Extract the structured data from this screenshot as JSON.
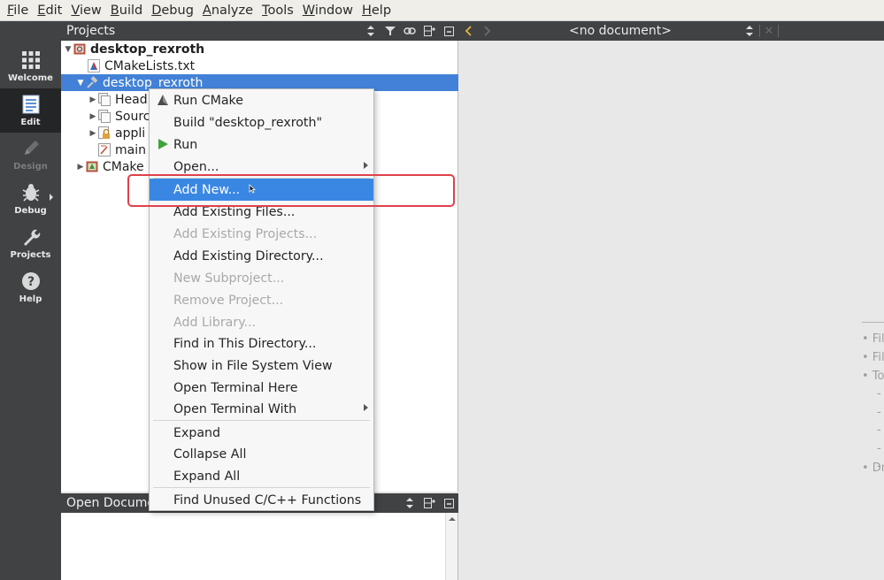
{
  "menubar": [
    "File",
    "Edit",
    "View",
    "Build",
    "Debug",
    "Analyze",
    "Tools",
    "Window",
    "Help"
  ],
  "modes": [
    {
      "label": "Welcome",
      "icon": "grid-icon",
      "state": "normal"
    },
    {
      "label": "Edit",
      "icon": "document-icon",
      "state": "active"
    },
    {
      "label": "Design",
      "icon": "pencil-icon",
      "state": "disabled"
    },
    {
      "label": "Debug",
      "icon": "bug-icon",
      "state": "normal"
    },
    {
      "label": "Projects",
      "icon": "wrench-icon",
      "state": "normal"
    },
    {
      "label": "Help",
      "icon": "help-icon",
      "state": "normal"
    }
  ],
  "projects_panel": {
    "title": "Projects",
    "tree": [
      {
        "label": "desktop_rexroth",
        "depth": 0,
        "expanded": true,
        "icon": "project-icon",
        "bold": true
      },
      {
        "label": "CMakeLists.txt",
        "depth": 1,
        "icon": "cmake-file-icon"
      },
      {
        "label": "desktop_rexroth",
        "depth": 1,
        "expanded": true,
        "icon": "hammer-icon",
        "selected": true
      },
      {
        "label": "Head",
        "depth": 2,
        "icon": "headers-folder-icon"
      },
      {
        "label": "Sourc",
        "depth": 2,
        "icon": "sources-folder-icon"
      },
      {
        "label": "appli",
        "depth": 2,
        "icon": "lock-folder-icon"
      },
      {
        "label": "main",
        "depth": 2,
        "icon": "source-file-icon"
      },
      {
        "label": "CMake",
        "depth": 1,
        "icon": "cmake-modules-icon"
      }
    ]
  },
  "open_documents": {
    "title": "Open Docume"
  },
  "editor": {
    "document_label": "<no document>",
    "hints": [
      "• File",
      "• File",
      "• Too",
      "-",
      "-",
      "-",
      "-",
      "-",
      "• Dra"
    ]
  },
  "context_menu": [
    {
      "label": "Run CMake",
      "icon": "cmake-icon"
    },
    {
      "label": "Build \"desktop_rexroth\""
    },
    {
      "label": "Run",
      "icon": "run-icon"
    },
    {
      "label": "Open...",
      "submenu": true
    },
    {
      "separator": true
    },
    {
      "label": "Add New...",
      "highlighted": true
    },
    {
      "label": "Add Existing Files..."
    },
    {
      "label": "Add Existing Projects...",
      "disabled": true
    },
    {
      "label": "Add Existing Directory..."
    },
    {
      "label": "New Subproject...",
      "disabled": true
    },
    {
      "label": "Remove Project...",
      "disabled": true
    },
    {
      "label": "Add Library...",
      "disabled": true
    },
    {
      "label": "Find in This Directory..."
    },
    {
      "label": "Show in File System View"
    },
    {
      "label": "Open Terminal Here"
    },
    {
      "label": "Open Terminal With",
      "submenu": true
    },
    {
      "separator": true
    },
    {
      "label": "Expand"
    },
    {
      "label": "Collapse All"
    },
    {
      "label": "Expand All"
    },
    {
      "separator": true
    },
    {
      "label": "Find Unused C/C++ Functions"
    }
  ],
  "colors": {
    "selection": "#4281d7",
    "menu_highlight": "#3a87e3",
    "callout": "#e0414b",
    "modebar": "#404244"
  }
}
